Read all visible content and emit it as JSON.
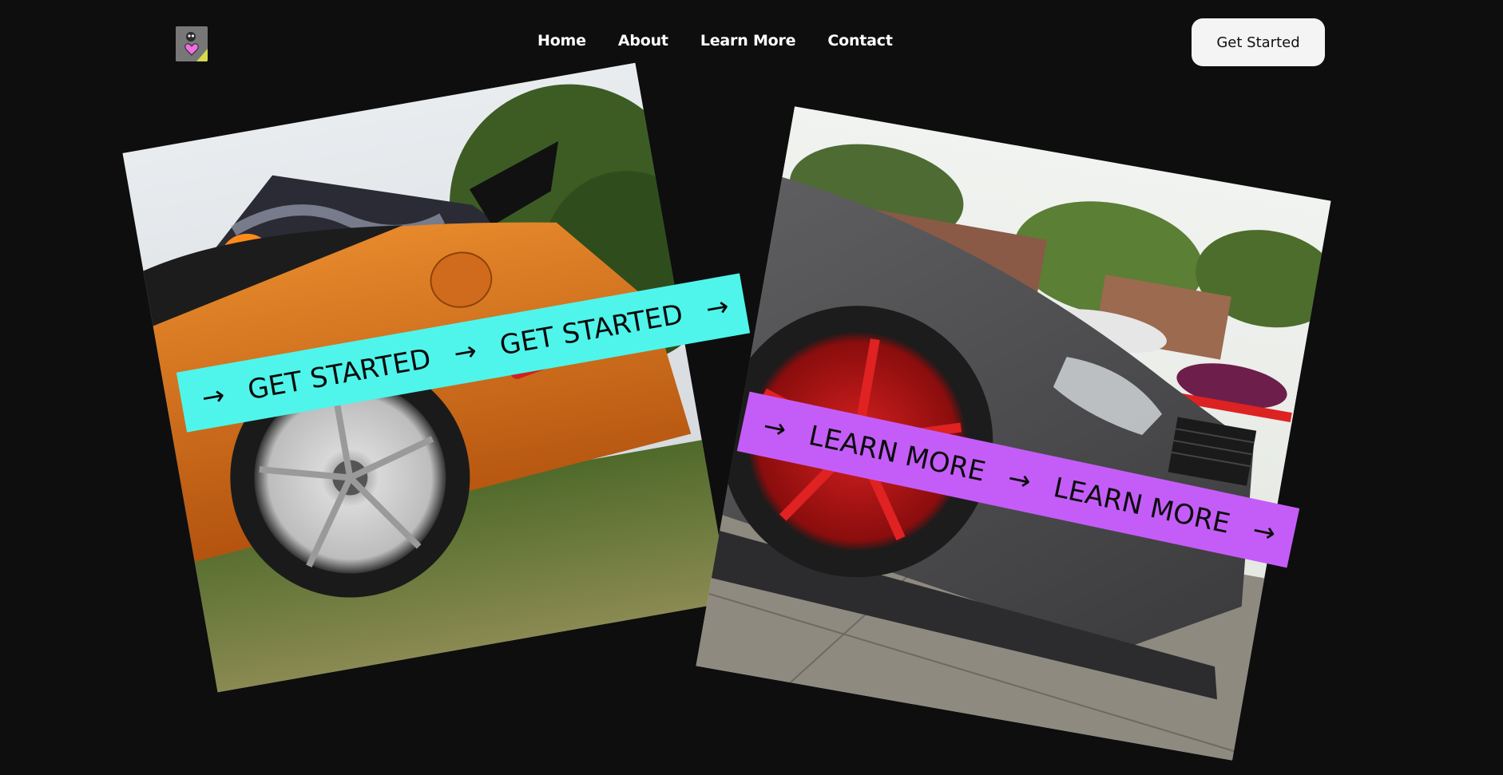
{
  "nav": {
    "logo_icon": "heart-cat-logo-icon",
    "links": [
      "Home",
      "About",
      "Learn More",
      "Contact"
    ],
    "cta_label": "Get Started"
  },
  "cards": [
    {
      "image": "orange-sports-car-photo",
      "ribbon_color": "#4ff5ea",
      "ribbon_text": [
        "GET STARTED",
        "GET STARTED"
      ],
      "arrow_icon": "arrow-right-icon"
    },
    {
      "image": "grey-mercedes-red-wheel-photo",
      "ribbon_color": "#c45df8",
      "ribbon_text": [
        "LEARN MORE",
        "LEARN MORE"
      ],
      "arrow_icon": "arrow-right-icon"
    }
  ],
  "colors": {
    "background": "#0e0e0e",
    "cta_bg": "#f4f4f4",
    "cyan": "#4ff5ea",
    "purple": "#c45df8"
  }
}
